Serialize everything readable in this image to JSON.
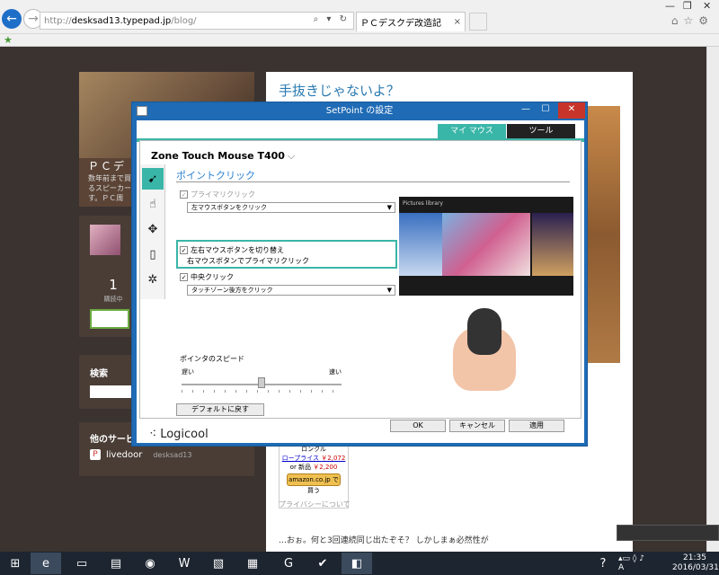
{
  "browser": {
    "url_prefix": "http://",
    "url_domain": "desksad13.typepad.jp",
    "url_path": "/blog/",
    "tab_title": "ＰＣデスクデ改造記",
    "tab_close": "×"
  },
  "blog": {
    "profile_title": "ＰＣデ",
    "profile_desc1": "数年前まで買",
    "profile_desc2": "るスピーカー",
    "profile_desc3": "す。ＰＣ周",
    "count": "1",
    "count_label": "購読中",
    "search_title": "検索",
    "other_title": "他のサービ",
    "livedoor": "livedoor",
    "livedoor_user": "desksad13",
    "post_title": "手抜きじゃないよ？",
    "amazon_l1": "ロンクル",
    "amazon_l2_a": "ロープライス",
    "amazon_l2_b": "￥2,072",
    "amazon_l3_a": "or 新品",
    "amazon_l3_b": "￥2,200",
    "amazon_btn": "amazon.co.jp で買う",
    "privacy": "プライバシーについて",
    "body_text": "…おぉ。何と3回連続同じ出たぞそ？ しかしまぁ必然性が"
  },
  "dialog": {
    "title": "SetPoint の設定",
    "tab_mymouse": "マイ マウス",
    "tab_tools": "ツール",
    "device": "Zone Touch Mouse T400",
    "section": "ポイントクリック",
    "primary_label": "プライマリクリック",
    "primary_select": "左マウスボタンをクリック",
    "swap_label": "左右マウスボタンを切り替え",
    "swap_sub": "右マウスボタンでプライマリクリック",
    "middle_label": "中央クリック",
    "middle_select": "タッチゾーン後方をクリック",
    "pictures_label": "Pictures library",
    "speed_label": "ポインタのスピード",
    "slow": "遅い",
    "fast": "速い",
    "pointer_speed": 0.5,
    "default_btn": "デフォルトに戻す",
    "brand": "Logicool",
    "ok": "OK",
    "cancel": "キャンセル",
    "apply": "適用"
  },
  "taskbar": {
    "time": "21:35",
    "date": "2016/03/31"
  },
  "colors": {
    "accent": "#3ab6a8",
    "title_bar": "#1f6bb5",
    "close": "#c7352a"
  }
}
